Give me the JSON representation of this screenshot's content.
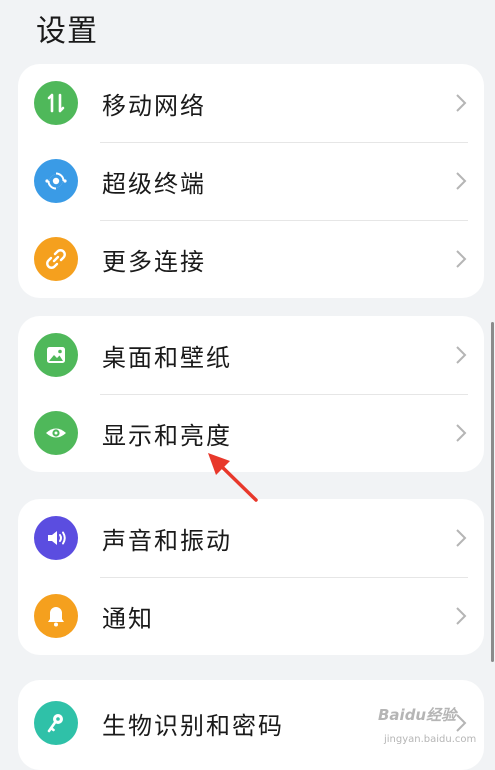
{
  "header": {
    "title": "设置"
  },
  "groups": [
    {
      "items": [
        {
          "label": "移动网络",
          "icon": "mobile-network-icon",
          "color": "#4fb85a"
        },
        {
          "label": "超级终端",
          "icon": "super-device-icon",
          "color": "#3a9be6"
        },
        {
          "label": "更多连接",
          "icon": "link-icon",
          "color": "#f5a01e"
        }
      ]
    },
    {
      "items": [
        {
          "label": "桌面和壁纸",
          "icon": "wallpaper-icon",
          "color": "#4fb85a"
        },
        {
          "label": "显示和亮度",
          "icon": "eye-icon",
          "color": "#4fb85a"
        }
      ]
    },
    {
      "items": [
        {
          "label": "声音和振动",
          "icon": "speaker-icon",
          "color": "#5b4de0"
        },
        {
          "label": "通知",
          "icon": "bell-icon",
          "color": "#f5a01e"
        }
      ]
    },
    {
      "items": [
        {
          "label": "生物识别和密码",
          "icon": "key-icon",
          "color": "#2fc1a8"
        }
      ]
    }
  ],
  "watermark": {
    "logo_text": "Baidu经验",
    "url_text": "jingyan.baidu.com"
  },
  "annotation": {
    "arrow_color": "#e8382b"
  }
}
